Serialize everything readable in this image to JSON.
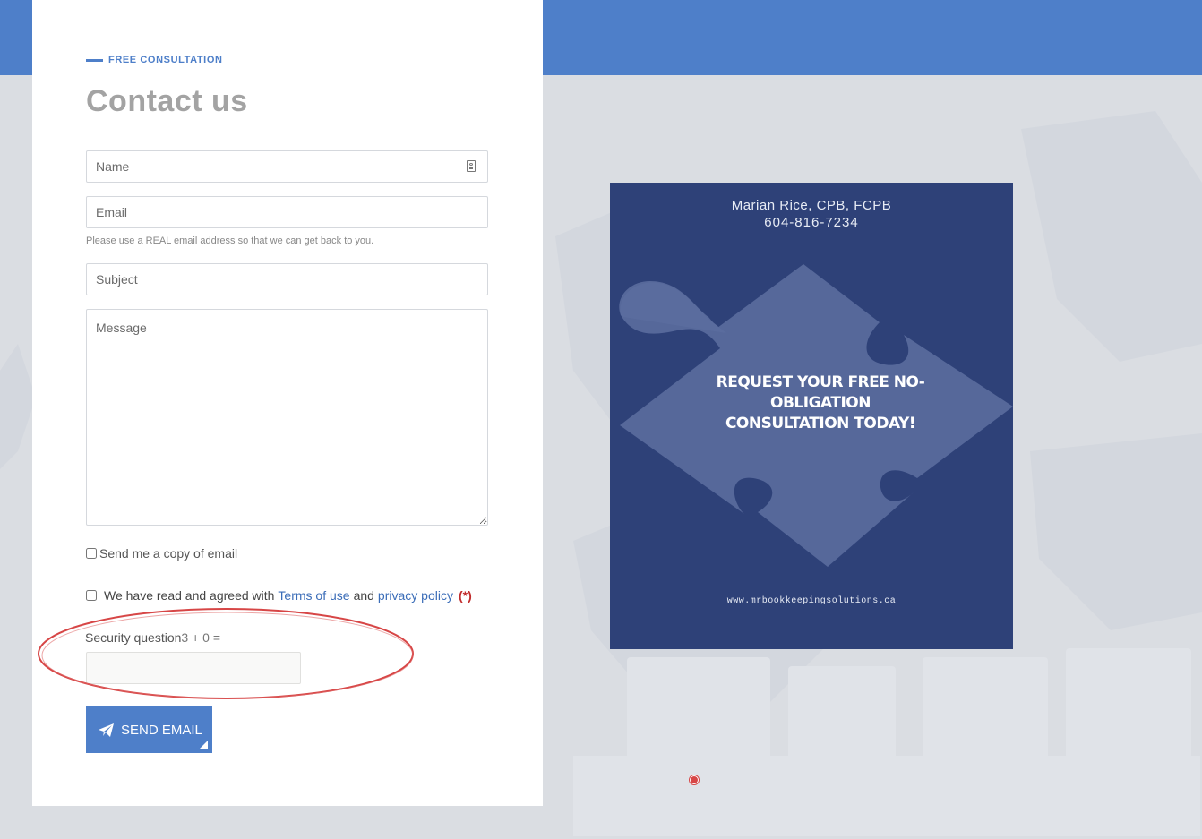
{
  "header": {
    "eyebrow": "FREE CONSULTATION",
    "title": "Contact us"
  },
  "form": {
    "name_placeholder": "Name",
    "email_placeholder": "Email",
    "email_hint": "Please use a REAL email address so that we can get back to you.",
    "subject_placeholder": "Subject",
    "message_placeholder": "Message",
    "copy_label": "Send me a copy of email",
    "agree_prefix": "We have read and agreed with",
    "terms_link": "Terms of use",
    "agree_and": "and",
    "privacy_link": "privacy policy",
    "required_mark": "(*)",
    "security_label": "Security question",
    "security_question": "3 + 0 =",
    "security_value": "",
    "send_label": "SEND EMAIL"
  },
  "promo": {
    "name": "Marian Rice, CPB, FCPB",
    "phone": "604-816-7234",
    "cta_line1": "REQUEST YOUR FREE NO-OBLIGATION",
    "cta_line2": "CONSULTATION TODAY!",
    "url": "www.mrbookkeepingsolutions.ca"
  },
  "colors": {
    "accent": "#4e7fc9",
    "promo_bg": "#2e4178",
    "annotation": "#d74646",
    "page_bg": "#dadde2"
  },
  "icons": {
    "name_field": "contact-card-icon",
    "send_button": "paper-plane-icon"
  }
}
